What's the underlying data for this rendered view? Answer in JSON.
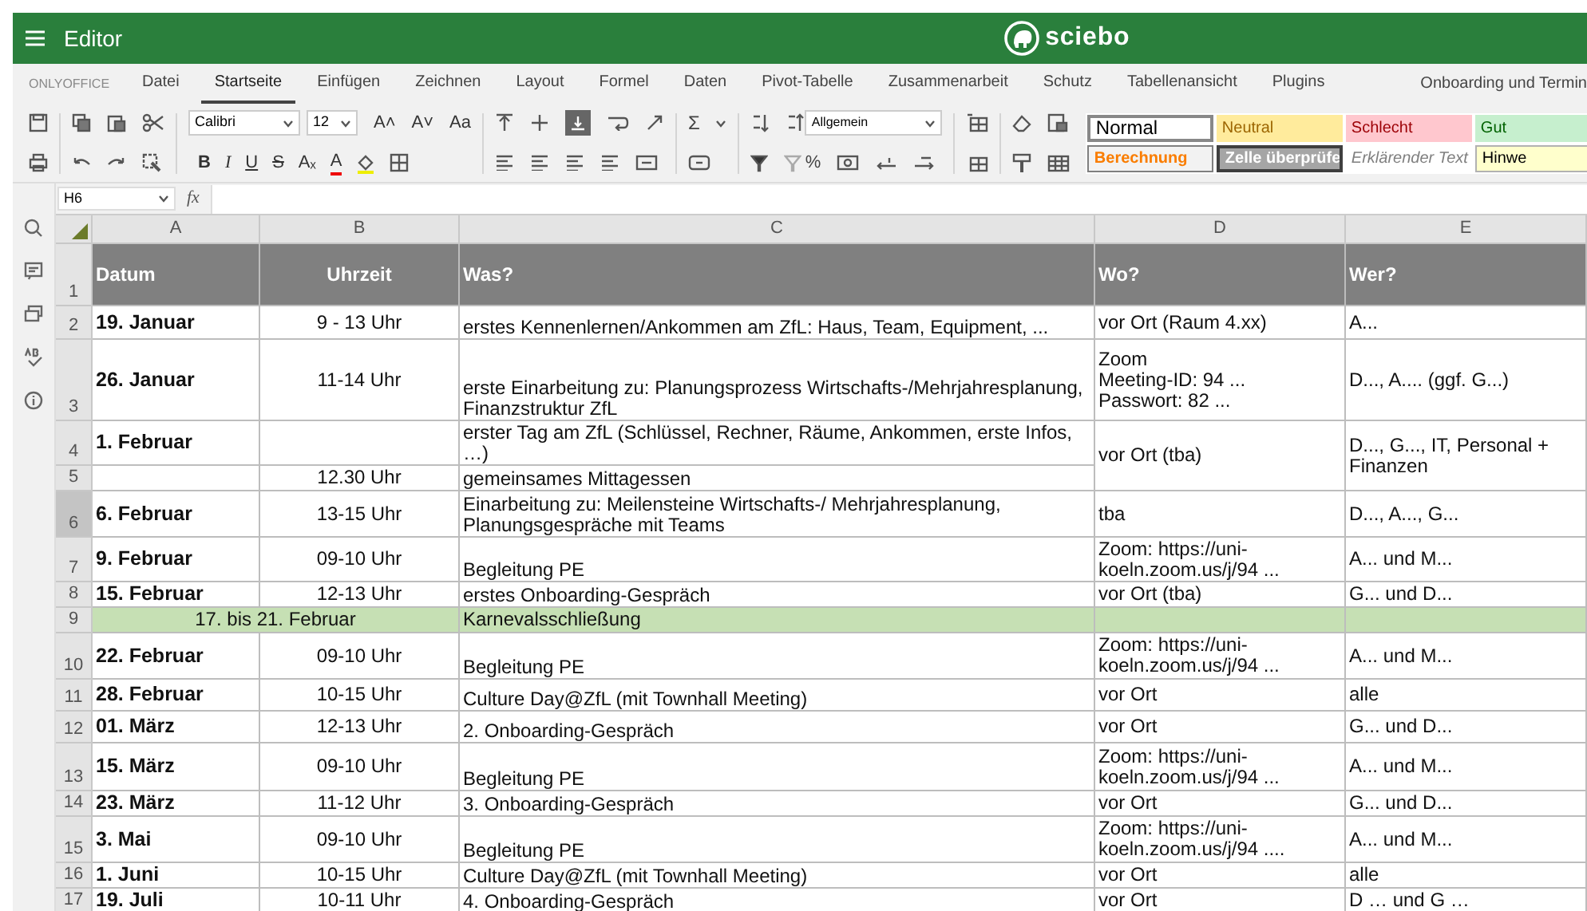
{
  "header": {
    "title": "Editor",
    "logo": "sciebo"
  },
  "menu": {
    "brand": "ONLYOFFICE",
    "tabs": [
      {
        "label": "Datei",
        "selected": false
      },
      {
        "label": "Startseite",
        "selected": true
      },
      {
        "label": "Einfügen",
        "selected": false
      },
      {
        "label": "Zeichnen",
        "selected": false
      },
      {
        "label": "Layout",
        "selected": false
      },
      {
        "label": "Formel",
        "selected": false
      },
      {
        "label": "Daten",
        "selected": false
      },
      {
        "label": "Pivot-Tabelle",
        "selected": false
      },
      {
        "label": "Zusammenarbeit",
        "selected": false
      },
      {
        "label": "Schutz",
        "selected": false
      },
      {
        "label": "Tabellenansicht",
        "selected": false
      },
      {
        "label": "Plugins",
        "selected": false
      }
    ],
    "document_title": "Onboarding und Termin"
  },
  "toolbar": {
    "font_name": "Calibri",
    "font_size": "12",
    "size_buttons": [
      "A˄",
      "A˅",
      "Aa"
    ],
    "format_buttons": [
      {
        "label": "B",
        "kind": "bold"
      },
      {
        "label": "I",
        "kind": "italic"
      },
      {
        "label": "U",
        "kind": "underline"
      },
      {
        "label": "S",
        "kind": "strike"
      },
      {
        "label": "Aₓ",
        "kind": "subscript"
      },
      {
        "label": "A",
        "kind": "font_color"
      }
    ],
    "sum_label": "Σ",
    "percent_label": "%",
    "number_format": "Allgemein",
    "cell_styles": [
      {
        "label": "Normal",
        "kind": "normal"
      },
      {
        "label": "Neutral",
        "kind": "neutral"
      },
      {
        "label": "Schlecht",
        "kind": "bad"
      },
      {
        "label": "Gut",
        "kind": "good"
      },
      {
        "label": "Berechnung",
        "kind": "calculation"
      },
      {
        "label": "Zelle überprüfe",
        "kind": "check"
      },
      {
        "label": "Erklärender Text",
        "kind": "explanatory"
      },
      {
        "label": "Hinwe",
        "kind": "note"
      }
    ]
  },
  "formula_bar": {
    "cell": "H6",
    "fx": "fx"
  },
  "sheet": {
    "columns": [
      "A",
      "B",
      "C",
      "D",
      "E"
    ],
    "rows": [
      {
        "number": "1",
        "selected": false,
        "kind": "header",
        "cells": [
          {
            "text": "Datum"
          },
          {
            "text": "Uhrzeit"
          },
          {
            "text": "Was?"
          },
          {
            "text": "Wo?"
          },
          {
            "text": "Wer?"
          }
        ]
      },
      {
        "number": "2",
        "selected": false,
        "kind": "entry",
        "cells": [
          {
            "text": "19. Januar"
          },
          {
            "text": "9 - 13 Uhr"
          },
          {
            "text": "erstes Kennenlernen/Ankommen am ZfL: Haus, Team, Equipment, ..."
          },
          {
            "text": "vor Ort (Raum 4.xx)"
          },
          {
            "text": "A..."
          }
        ]
      },
      {
        "number": "3",
        "selected": false,
        "kind": "entry",
        "cells": [
          {
            "text": "26. Januar"
          },
          {
            "text": "11-14 Uhr"
          },
          {
            "text": "erste Einarbeitung zu: Planungsprozess Wirtschafts-/Mehrjahresplanung, Finanzstruktur ZfL"
          },
          {
            "text": "Zoom\nMeeting-ID: 94 ...\nPasswort: 82 ..."
          },
          {
            "text": "D..., A.... (ggf. G...)"
          }
        ]
      },
      {
        "number": "4",
        "selected": false,
        "kind": "entry",
        "cells": [
          {
            "text": "1. Februar"
          },
          {
            "text": ""
          },
          {
            "text": "erster Tag am ZfL (Schlüssel, Rechner, Räume, Ankommen, erste Infos, …)"
          },
          {
            "text": "vor Ort (tba)",
            "spans_next_row": true
          },
          {
            "text": "D..., G..., IT, Personal + Finanzen",
            "spans_next_row": true
          }
        ]
      },
      {
        "number": "5",
        "selected": false,
        "kind": "entry",
        "cells": [
          {
            "text": ""
          },
          {
            "text": "12.30 Uhr"
          },
          {
            "text": "gemeinsames Mittagessen"
          }
        ]
      },
      {
        "number": "6",
        "selected": true,
        "kind": "entry",
        "cells": [
          {
            "text": "6. Februar"
          },
          {
            "text": "13-15 Uhr"
          },
          {
            "text": "Einarbeitung zu: Meilensteine Wirtschafts-/ Mehrjahresplanung, Planungsgespräche mit Teams"
          },
          {
            "text": "tba"
          },
          {
            "text": "D..., A..., G..."
          }
        ]
      },
      {
        "number": "7",
        "selected": false,
        "kind": "entry",
        "cells": [
          {
            "text": "9. Februar"
          },
          {
            "text": "09-10 Uhr"
          },
          {
            "text": "Begleitung PE"
          },
          {
            "text": "Zoom: https://uni-koeln.zoom.us/j/94 ..."
          },
          {
            "text": "A... und M..."
          }
        ]
      },
      {
        "number": "8",
        "selected": false,
        "kind": "entry",
        "cells": [
          {
            "text": "15. Februar"
          },
          {
            "text": "12-13 Uhr"
          },
          {
            "text": "erstes Onboarding-Gespräch"
          },
          {
            "text": "vor Ort (tba)"
          },
          {
            "text": "G... und D..."
          }
        ]
      },
      {
        "number": "9",
        "selected": false,
        "kind": "closure",
        "cells": [
          {
            "text": "17. bis 21. Februar",
            "spans_next_column": true
          },
          {
            "text": ""
          },
          {
            "text": "Karnevalsschließung"
          },
          {
            "text": ""
          },
          {
            "text": ""
          }
        ]
      },
      {
        "number": "10",
        "selected": false,
        "kind": "entry",
        "cells": [
          {
            "text": "22. Februar"
          },
          {
            "text": "09-10 Uhr"
          },
          {
            "text": "Begleitung PE"
          },
          {
            "text": "Zoom: https://uni-koeln.zoom.us/j/94 ..."
          },
          {
            "text": "A... und M..."
          }
        ]
      },
      {
        "number": "11",
        "selected": false,
        "kind": "entry",
        "cells": [
          {
            "text": "28. Februar"
          },
          {
            "text": "10-15 Uhr"
          },
          {
            "text": "Culture Day@ZfL (mit Townhall Meeting)"
          },
          {
            "text": "vor Ort"
          },
          {
            "text": "alle"
          }
        ]
      },
      {
        "number": "12",
        "selected": false,
        "kind": "entry",
        "cells": [
          {
            "text": "01. März"
          },
          {
            "text": "12-13 Uhr"
          },
          {
            "text": "2. Onboarding-Gespräch"
          },
          {
            "text": "vor Ort"
          },
          {
            "text": "G... und D..."
          }
        ]
      },
      {
        "number": "13",
        "selected": false,
        "kind": "entry",
        "cells": [
          {
            "text": "15. März"
          },
          {
            "text": "09-10 Uhr"
          },
          {
            "text": "Begleitung PE"
          },
          {
            "text": "Zoom: https://uni-koeln.zoom.us/j/94 ..."
          },
          {
            "text": "A... und M..."
          }
        ]
      },
      {
        "number": "14",
        "selected": false,
        "kind": "entry",
        "cells": [
          {
            "text": "23. März"
          },
          {
            "text": "11-12 Uhr"
          },
          {
            "text": "3. Onboarding-Gespräch"
          },
          {
            "text": "vor Ort"
          },
          {
            "text": "G... und D..."
          }
        ]
      },
      {
        "number": "15",
        "selected": false,
        "kind": "entry",
        "cells": [
          {
            "text": "3. Mai"
          },
          {
            "text": "09-10 Uhr"
          },
          {
            "text": "Begleitung PE"
          },
          {
            "text": "Zoom: https://uni-koeln.zoom.us/j/94 ...."
          },
          {
            "text": "A... und M..."
          }
        ]
      },
      {
        "number": "16",
        "selected": false,
        "kind": "entry",
        "cells": [
          {
            "text": "1. Juni"
          },
          {
            "text": "10-15 Uhr"
          },
          {
            "text": "Culture Day@ZfL (mit Townhall Meeting)"
          },
          {
            "text": "vor Ort"
          },
          {
            "text": "alle"
          }
        ]
      },
      {
        "number": "17",
        "selected": false,
        "kind": "entry",
        "cells": [
          {
            "text": "19. Juli"
          },
          {
            "text": "10-11 Uhr"
          },
          {
            "text": "4. Onboarding-Gespräch"
          },
          {
            "text": "vor Ort"
          },
          {
            "text": "D … und G …"
          }
        ]
      }
    ]
  }
}
